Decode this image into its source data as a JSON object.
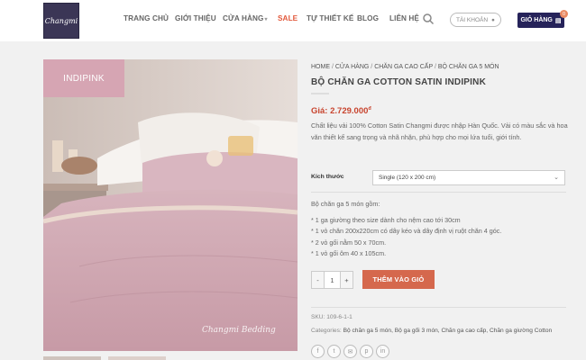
{
  "header": {
    "logo_text": "Changmi",
    "nav": [
      {
        "label": "TRANG CHỦ"
      },
      {
        "label": "GIỚI THIỆU"
      },
      {
        "label": "CỬA HÀNG"
      },
      {
        "label": "SALE"
      },
      {
        "label": "TỰ THIẾT KẾ"
      },
      {
        "label": "BLOG"
      },
      {
        "label": "LIÊN HỆ"
      }
    ],
    "account_label": "TÀI KHOẢN",
    "cart_label": "GIỎ HÀNG",
    "cart_count": "0",
    "accent": "#26235a",
    "sale_color": "#e2583b"
  },
  "gallery": {
    "tag": "INDIPINK",
    "signature": "Changmi Bedding"
  },
  "product": {
    "breadcrumb": [
      "HOME",
      "CỬA HÀNG",
      "CHĂN GA CAO CẤP",
      "BỘ CHĂN GA 5 MÓN"
    ],
    "title": "BỘ CHĂN GA COTTON SATIN INDIPINK",
    "price_label": "Giá:",
    "price": "2.729.000",
    "currency": "đ",
    "description": "Chất liệu vải 100% Cotton Satin Changmi được nhập Hàn Quốc. Vải có màu sắc và hoa văn thiết kế sang trọng và nhã nhặn, phù hợp cho mọi lứa tuổi, giới tính.",
    "variation_label": "Kích thước",
    "variation_value": "Single (120 x 200 cm)",
    "set_title": "Bộ chăn ga 5 món gồm:",
    "set_items": [
      "* 1 ga giường theo size dành cho nệm cao tới 30cm",
      "* 1 vỏ chăn 200x220cm có dây kéo và dây định vị ruột chăn 4 góc.",
      "* 2 vỏ gối nằm 50 x 70cm.",
      "* 1 vỏ gối ôm 40 x 105cm."
    ],
    "qty_minus": "-",
    "qty_value": "1",
    "qty_plus": "+",
    "add_to_cart": "THÊM VÀO GIỎ",
    "add_color": "#d5684d",
    "sku_label": "SKU:",
    "sku": "109-6-1-1",
    "categories_label": "Categories:",
    "categories": "Bộ chăn ga 5 món, Bộ ga gối 3 món, Chăn ga cao cấp, Chăn ga giường Cotton",
    "social_icons": [
      "facebook-icon",
      "twitter-icon",
      "email-icon",
      "pinterest-icon",
      "linkedin-icon"
    ]
  }
}
